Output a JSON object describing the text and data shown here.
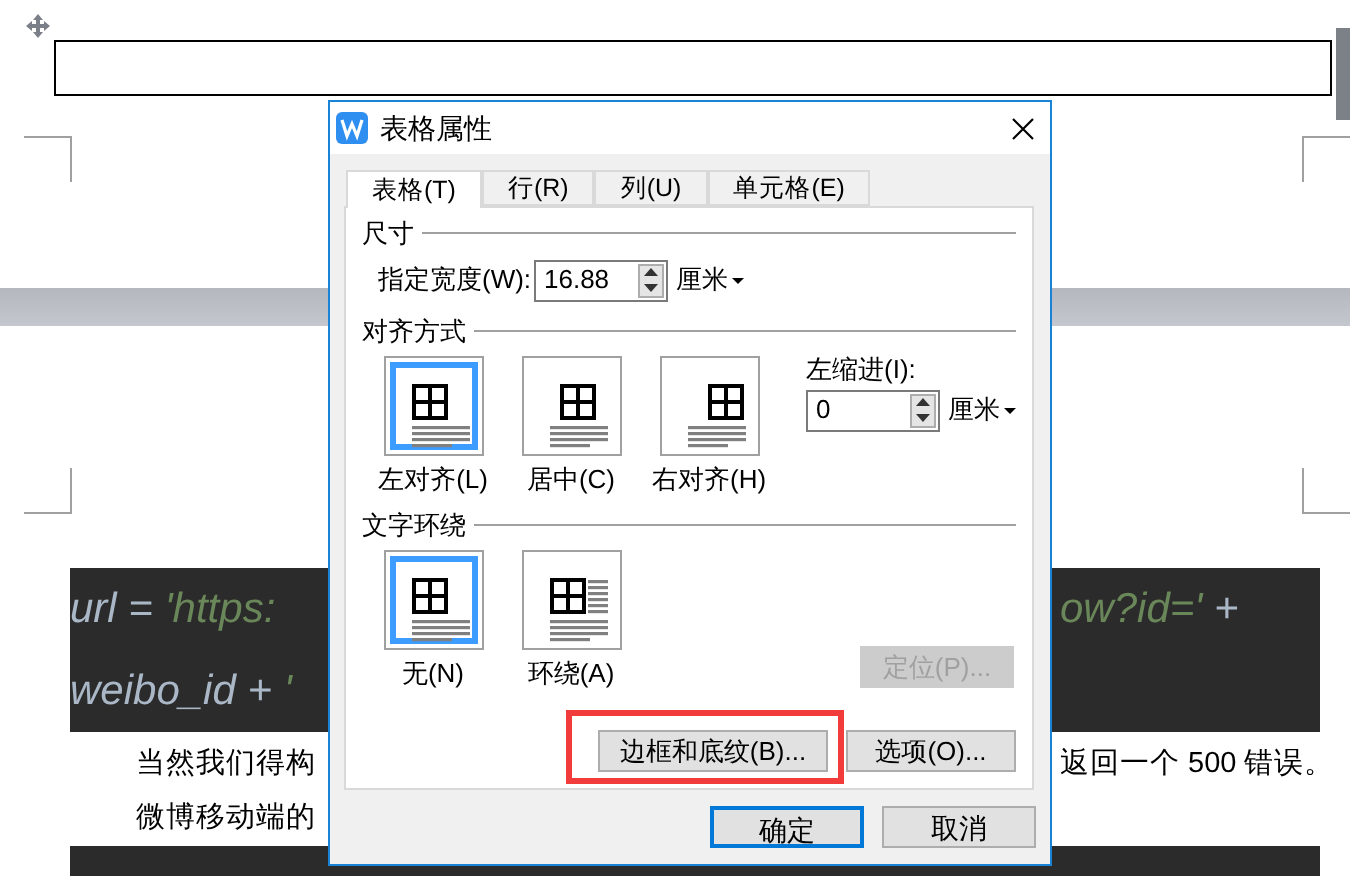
{
  "document": {
    "code_lines": [
      {
        "left": [
          {
            "text": "url = ",
            "kind": "name"
          },
          {
            "text": "'https:",
            "kind": "string"
          }
        ],
        "right": [
          {
            "text": "ow?id='",
            "kind": "string"
          },
          {
            "text": " +",
            "kind": "name"
          }
        ]
      },
      {
        "left": [
          {
            "text": "weibo_id + ",
            "kind": "name"
          },
          {
            "text": "'",
            "kind": "string"
          }
        ]
      }
    ],
    "paragraph_lines": [
      {
        "left": "当然我们得构",
        "right": "返回一个 500 错误。"
      },
      {
        "left": "微博移动端的"
      }
    ]
  },
  "dialog": {
    "title": "表格属性",
    "tabs": [
      {
        "label": "表格(T)",
        "selected": true
      },
      {
        "label": "行(R)",
        "selected": false
      },
      {
        "label": "列(U)",
        "selected": false
      },
      {
        "label": "单元格(E)",
        "selected": false
      }
    ],
    "size_section": {
      "title": "尺寸",
      "width_label": "指定宽度(W):",
      "width_value": "16.88",
      "unit": "厘米"
    },
    "alignment_section": {
      "title": "对齐方式",
      "options": [
        {
          "label": "左对齐(L)",
          "kind": "left",
          "selected": true
        },
        {
          "label": "居中(C)",
          "kind": "center",
          "selected": false
        },
        {
          "label": "右对齐(H)",
          "kind": "right",
          "selected": false
        }
      ],
      "indent_label": "左缩进(I):",
      "indent_value": "0",
      "indent_unit": "厘米"
    },
    "wrap_section": {
      "title": "文字环绕",
      "options": [
        {
          "label": "无(N)",
          "kind": "none",
          "selected": true
        },
        {
          "label": "环绕(A)",
          "kind": "around",
          "selected": false
        }
      ]
    },
    "position_button": {
      "label": "定位(P)...",
      "disabled": true
    },
    "buttons": [
      {
        "label": "边框和底纹(B)...",
        "highlighted": true
      },
      {
        "label": "选项(O)...",
        "highlighted": false
      }
    ],
    "footer_buttons": [
      {
        "label": "确定",
        "default": true
      },
      {
        "label": "取消",
        "default": false
      }
    ]
  }
}
